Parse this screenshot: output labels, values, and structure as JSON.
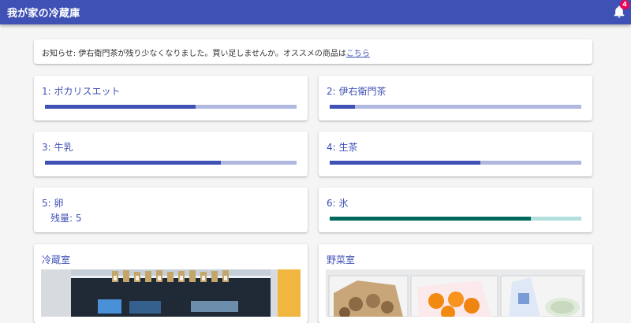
{
  "app": {
    "title": "我が家の冷蔵庫",
    "notification_count": "4"
  },
  "notice": {
    "text": "お知らせ: 伊右衛門茶が残り少なくなりました。買い足しませんか。オススメの商品は",
    "link_text": "こちら"
  },
  "items": [
    {
      "label": "1: ポカリスエット",
      "level": 0.6,
      "color": "#3f51b5"
    },
    {
      "label": "2: 伊右衛門茶",
      "level": 0.1,
      "color": "#3f51b5"
    },
    {
      "label": "3: 牛乳",
      "level": 0.7,
      "color": "#3f51b5"
    },
    {
      "label": "4: 生茶",
      "level": 0.6,
      "color": "#3f51b5"
    },
    {
      "label": "5: 卵",
      "remaining": "残量: 5"
    },
    {
      "label": "6: 氷",
      "level": 0.8,
      "color": "#00695c"
    }
  ],
  "compartments": [
    {
      "label": "冷蔵室"
    },
    {
      "label": "野菜室"
    }
  ]
}
